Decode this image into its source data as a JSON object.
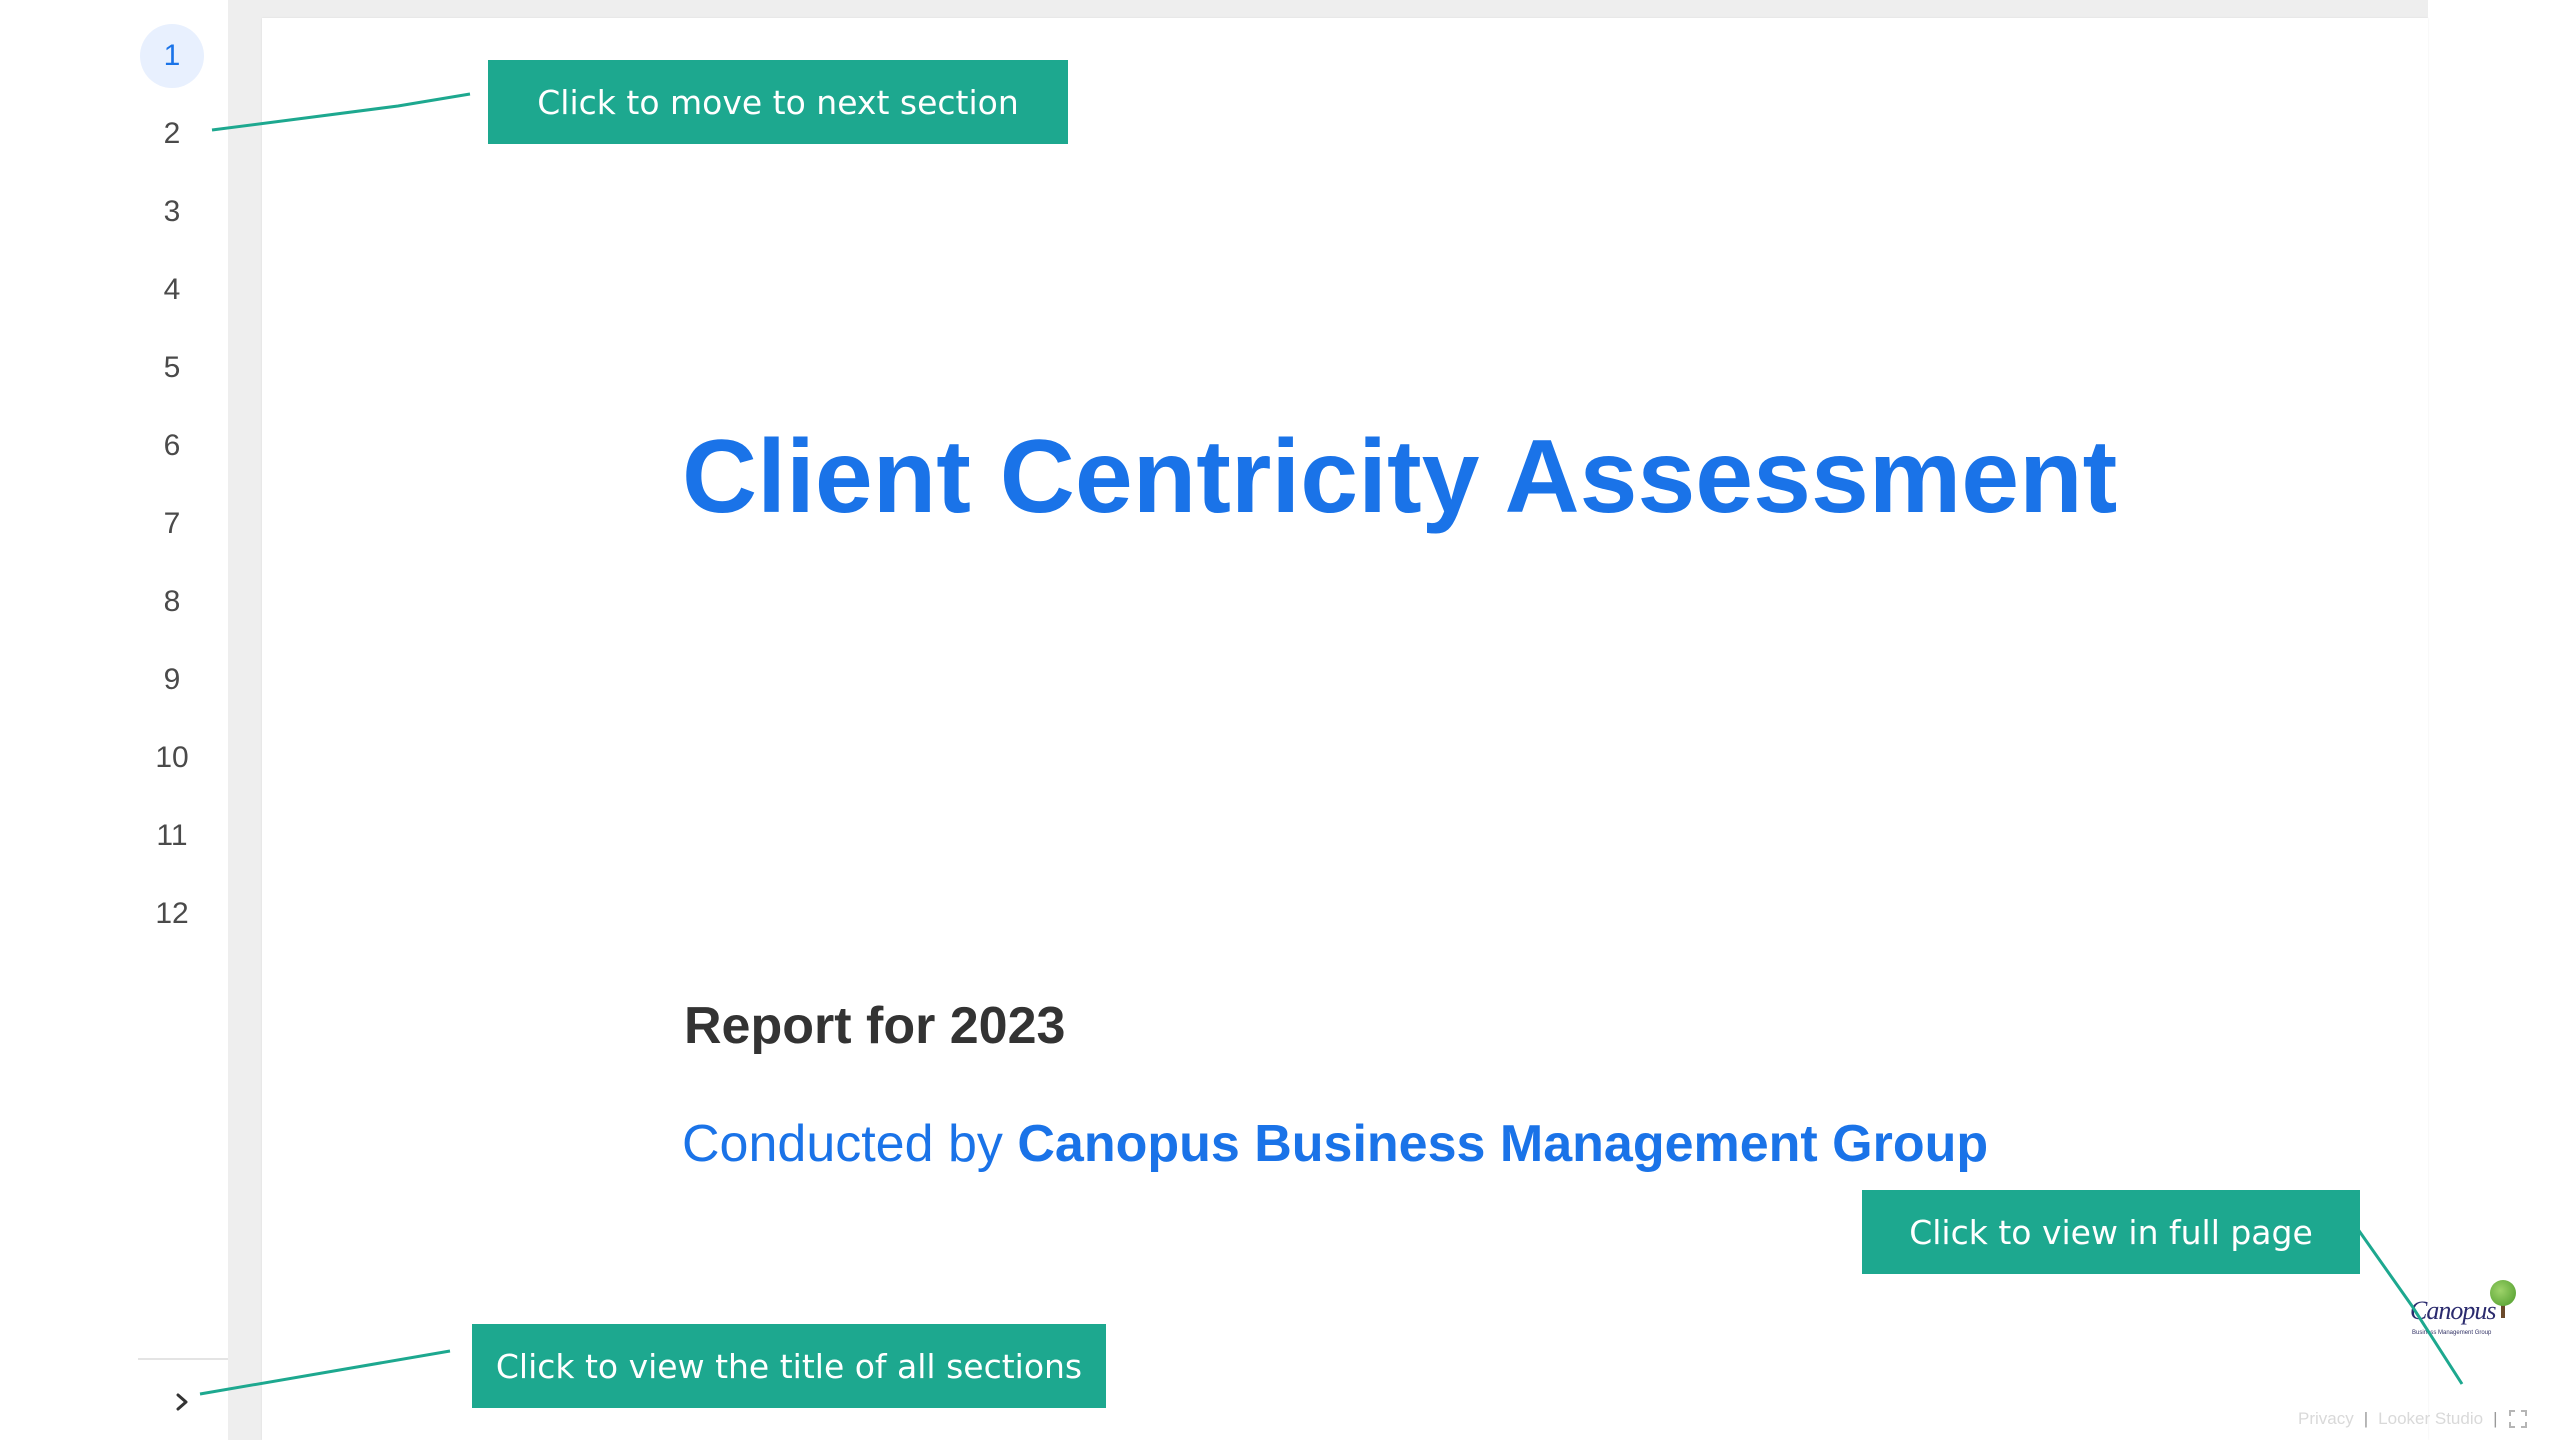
{
  "page_nav": {
    "pages": [
      "1",
      "2",
      "3",
      "4",
      "5",
      "6",
      "7",
      "8",
      "9",
      "10",
      "11",
      "12"
    ],
    "active_page": "1",
    "expand_icon": "chevron-right-icon"
  },
  "report": {
    "title": "Client Centricity Assessment",
    "subtitle": "Report for 2023",
    "conducted_prefix": "Conducted by",
    "conducted_org": "Canopus Business Management Group"
  },
  "logo": {
    "wordmark": "Canopus",
    "tagline": "Business Management Group"
  },
  "footer": {
    "privacy_label": "Privacy",
    "separator": "|",
    "studio_label": "Looker Studio",
    "fullscreen_icon": "fullscreen-icon"
  },
  "callouts": {
    "next_section": "Click to move to next section",
    "full_page": "Click to view in full page",
    "all_sections": "Click to view the title of all sections"
  },
  "colors": {
    "accent_blue": "#1a73e8",
    "callout_teal": "#1da88f",
    "active_page_bg": "#e8f0fe",
    "gutter_grey": "#eeeeee"
  }
}
